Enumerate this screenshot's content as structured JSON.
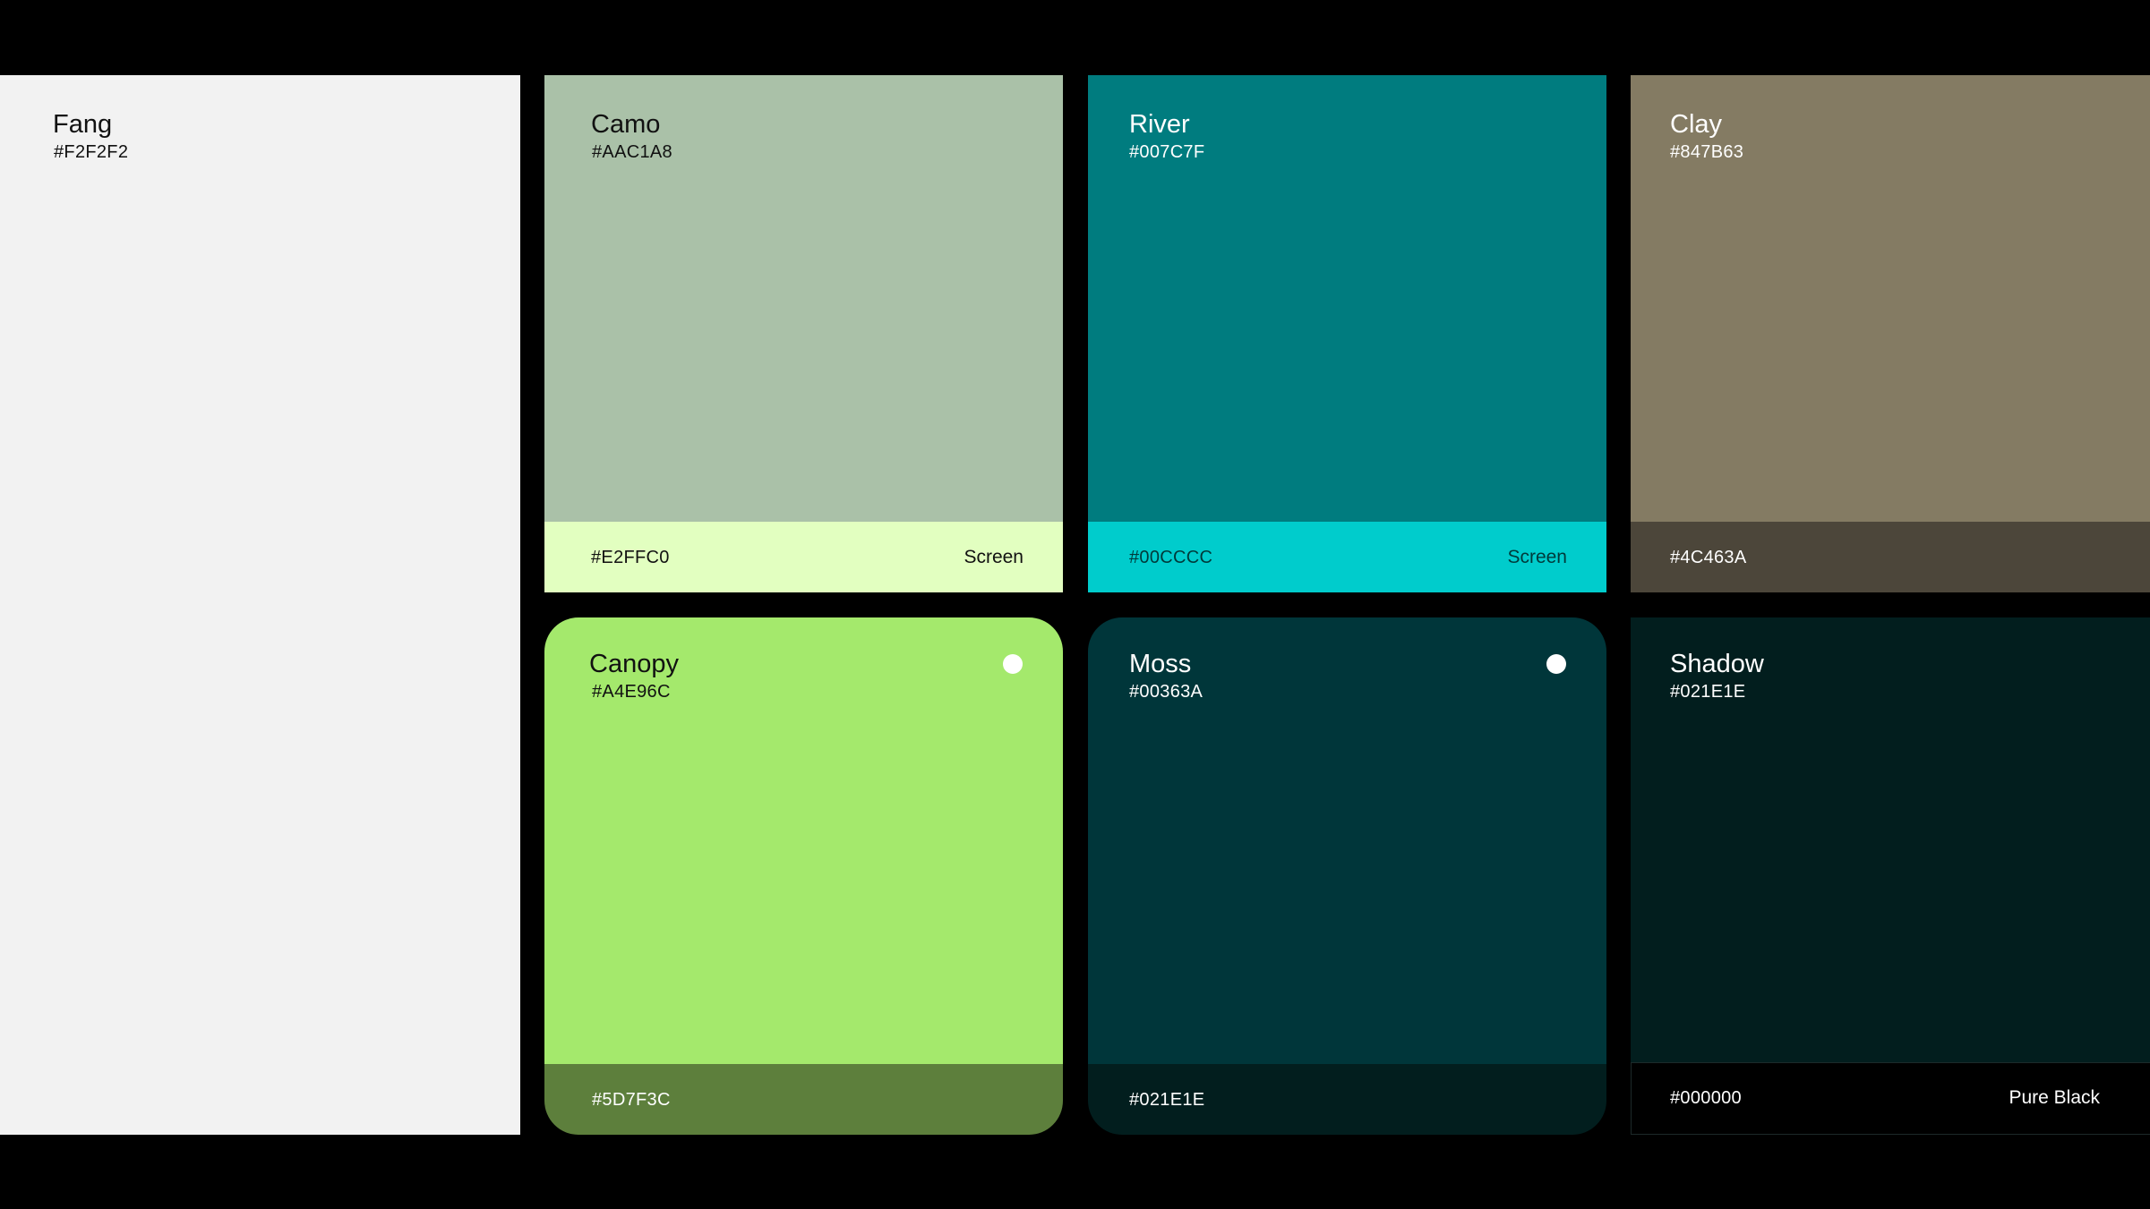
{
  "swatches": {
    "fang": {
      "name": "Fang",
      "hex": "#F2F2F2"
    },
    "camo": {
      "name": "Camo",
      "hex": "#AAC1A8",
      "sub_hex": "#E2FFC0",
      "sub_tag": "Screen"
    },
    "river": {
      "name": "River",
      "hex": "#007C7F",
      "sub_hex": "#00CCCC",
      "sub_tag": "Screen"
    },
    "clay": {
      "name": "Clay",
      "hex": "#847B63",
      "sub_hex": "#4C463A"
    },
    "canopy": {
      "name": "Canopy",
      "hex": "#A4E96C",
      "sub_hex": "#5D7F3C"
    },
    "moss": {
      "name": "Moss",
      "hex": "#00363A",
      "sub_hex": "#021E1E"
    },
    "shadow": {
      "name": "Shadow",
      "hex": "#021E1E",
      "sub_hex": "#000000",
      "sub_tag": "Pure Black"
    }
  },
  "colors": {
    "background": "#000000",
    "fang": "#F2F2F2",
    "camo": "#AAC1A8",
    "camo_sub": "#E2FFC0",
    "river": "#007C7F",
    "river_sub": "#00CCCC",
    "clay": "#847B63",
    "clay_sub": "#4C463A",
    "canopy": "#A4E96C",
    "canopy_sub": "#5D7F3C",
    "moss": "#00363A",
    "moss_sub": "#021E1E",
    "shadow": "#021E1E",
    "shadow_sub": "#000000",
    "indicator_dot": "#FFFFFF"
  },
  "icons": [
    "indicator-dot-icon"
  ]
}
